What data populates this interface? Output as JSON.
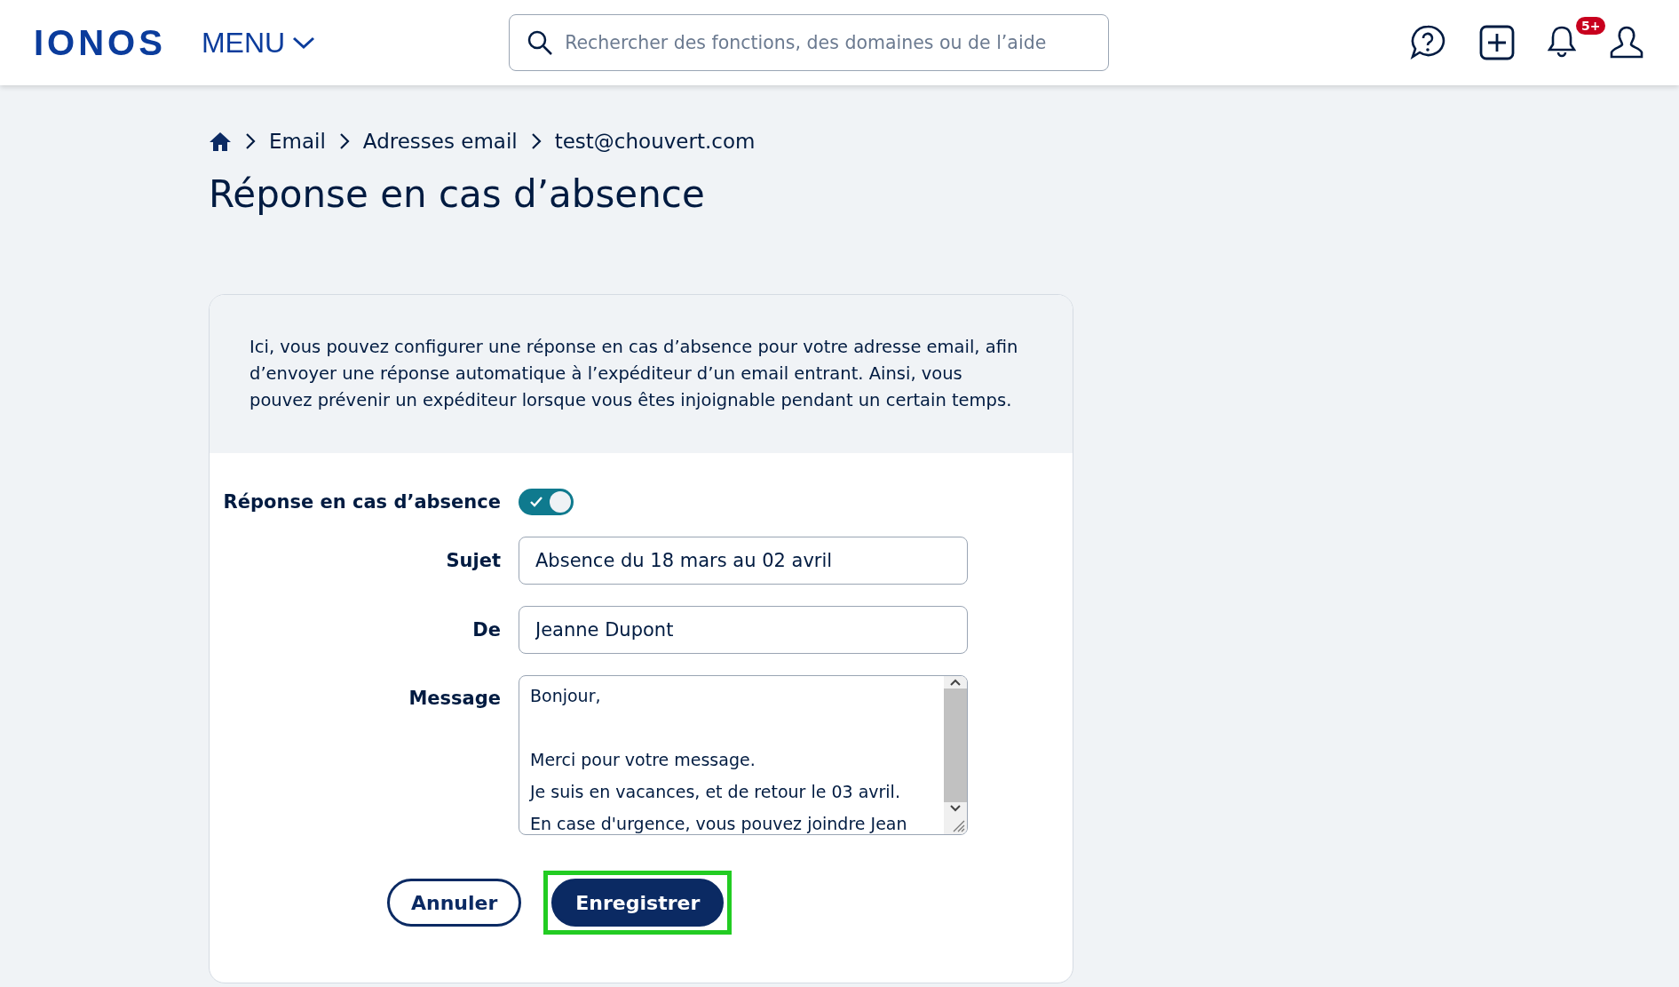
{
  "header": {
    "logo": "IONOS",
    "menu": "MENU",
    "search": {
      "placeholder": "Rechercher des fonctions, des domaines ou de l’aide"
    },
    "notifications_badge": "5+"
  },
  "breadcrumb": [
    "Email",
    "Adresses email",
    "test@chouvert.com"
  ],
  "title": "Réponse en cas d’absence",
  "intro": "Ici, vous pouvez configurer une réponse en cas d’absence pour votre adresse email, afin d’envoyer une réponse automatique à l’expéditeur d’un email entrant. Ainsi, vous pouvez prévenir un expéditeur lorsque vous êtes injoignable pendant un certain temps.",
  "form": {
    "toggle": {
      "label": "Réponse en cas d’absence",
      "on": true
    },
    "fields": [
      {
        "label": "Sujet",
        "value": "Absence du 18 mars au 02 avril"
      },
      {
        "label": "De",
        "value": "Jeanne Dupont"
      }
    ],
    "message": {
      "label": "Message",
      "value": "Bonjour,\n\nMerci pour votre message.\nJe suis en vacances, et de retour le 03 avril.\nEn case d'urgence, vous pouvez joindre Jean"
    }
  },
  "buttons": [
    {
      "label": "Annuler",
      "kind": "secondary",
      "highlighted": false
    },
    {
      "label": "Enregistrer",
      "kind": "primary",
      "highlighted": true
    }
  ]
}
